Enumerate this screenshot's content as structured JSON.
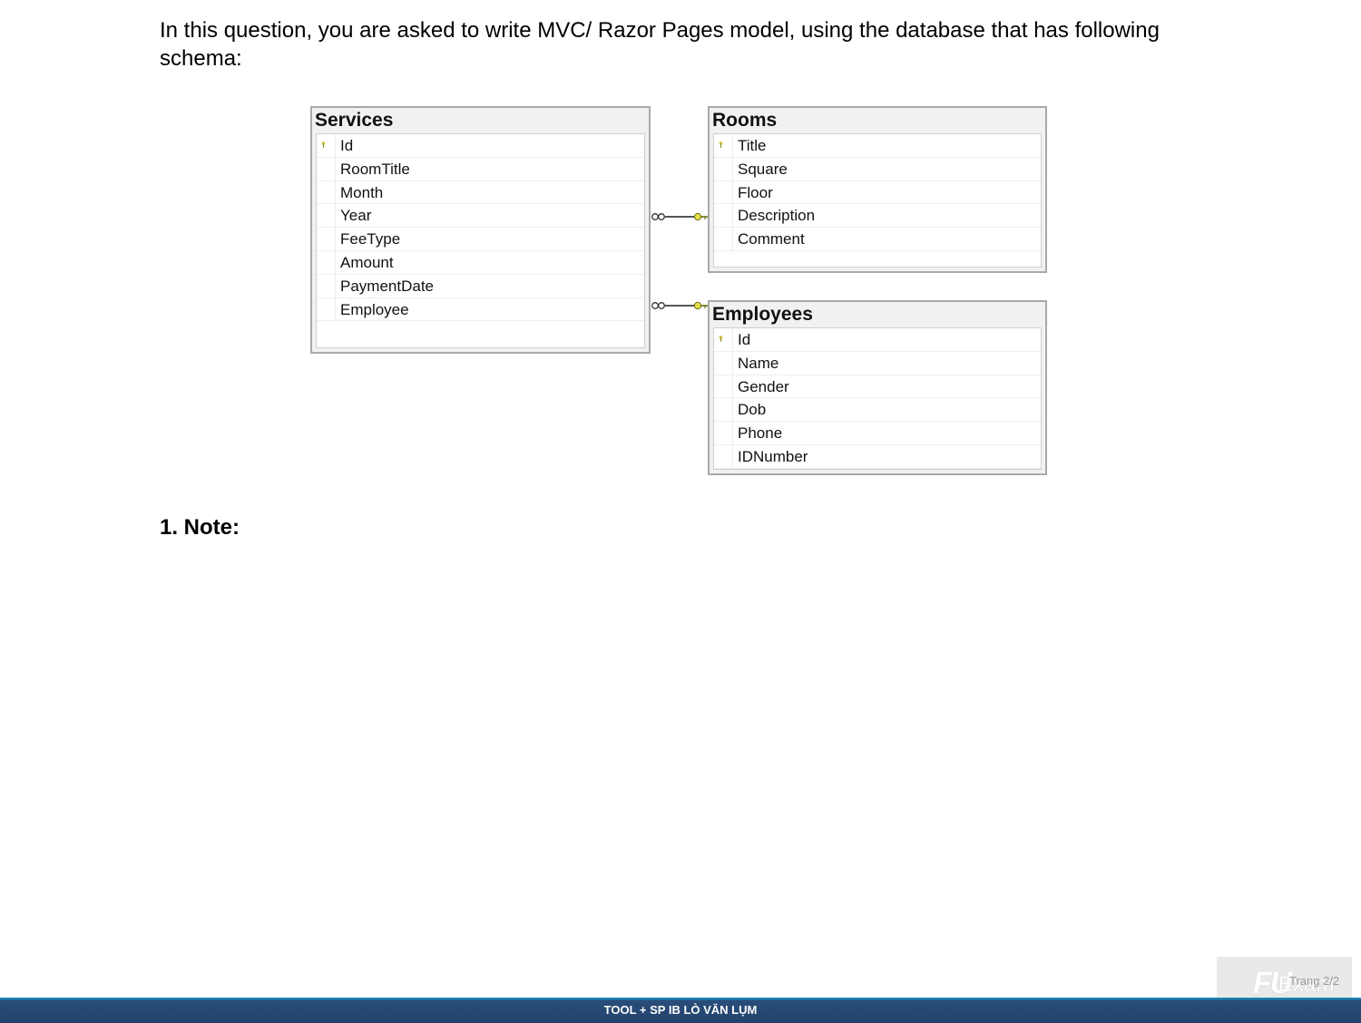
{
  "intro_text": "In this question, you are asked to write MVC/ Razor Pages model, using the database that has following schema:",
  "tables": {
    "services": {
      "name": "Services",
      "columns": [
        "Id",
        "RoomTitle",
        "Month",
        "Year",
        "FeeType",
        "Amount",
        "PaymentDate",
        "Employee"
      ]
    },
    "rooms": {
      "name": "Rooms",
      "columns": [
        "Title",
        "Square",
        "Floor",
        "Description",
        "Comment"
      ]
    },
    "employees": {
      "name": "Employees",
      "columns": [
        "Id",
        "Name",
        "Gender",
        "Dob",
        "Phone",
        "IDNumber"
      ]
    }
  },
  "note_heading": "1.  Note:",
  "footer_text": "TOOL + SP IB LÒ VĂN LỤM",
  "watermark": {
    "logo": "FU",
    "exam": "Exam",
    "page": "Trang 2/2"
  }
}
